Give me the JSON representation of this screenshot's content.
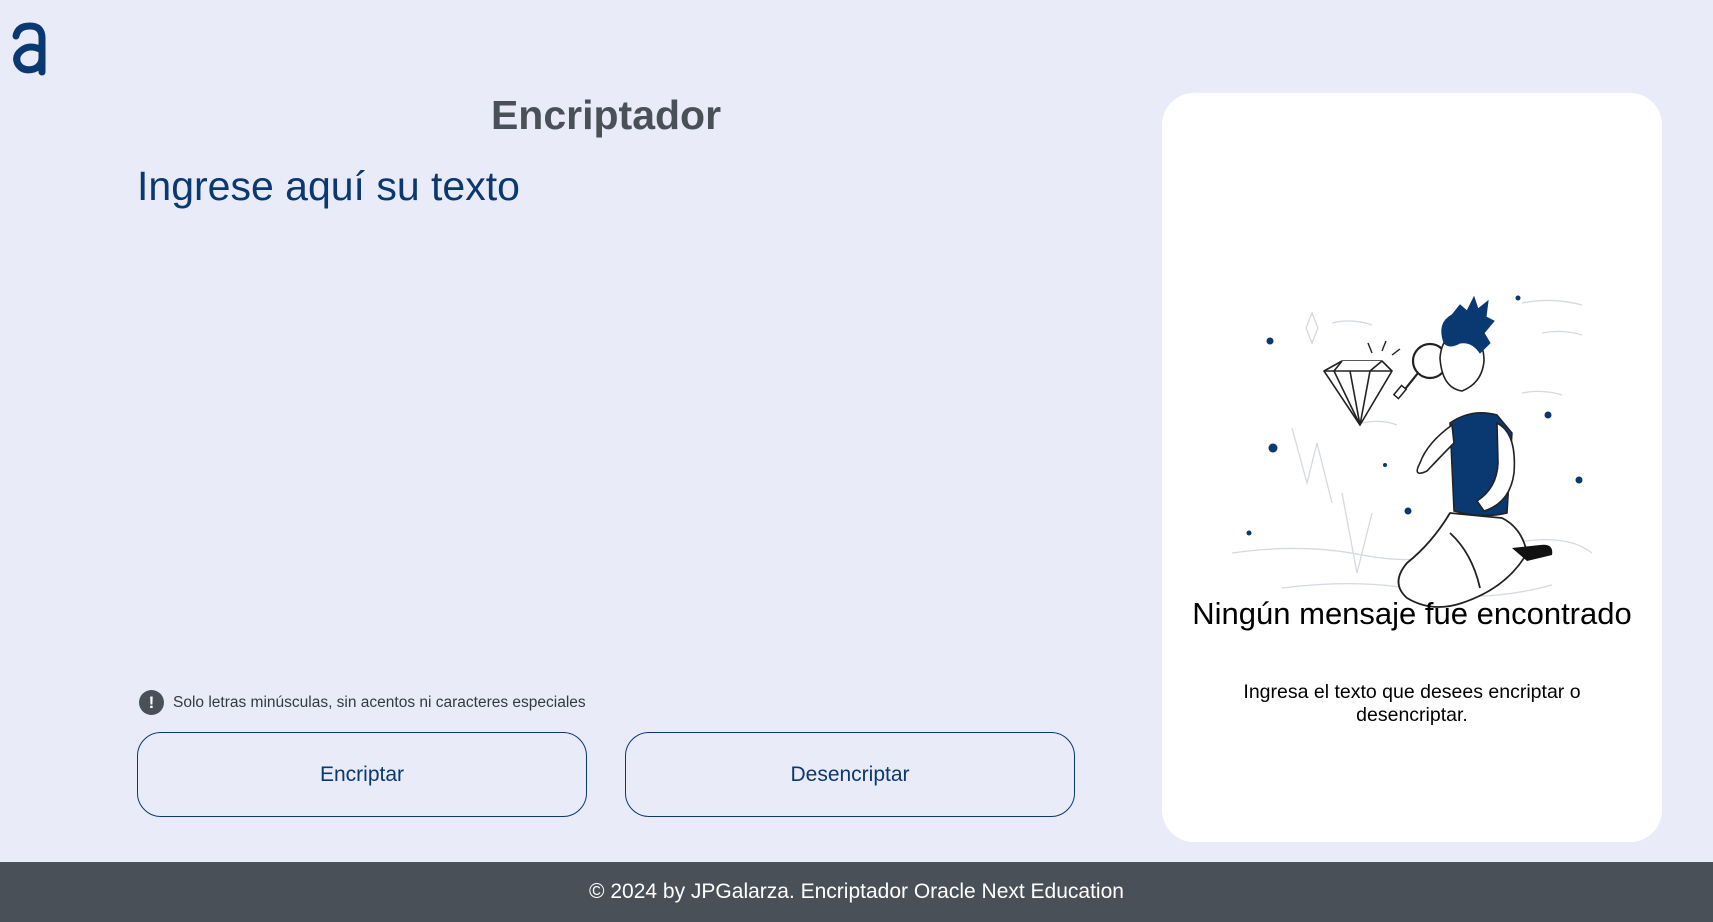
{
  "header": {
    "logo_letter": "a",
    "title": "Encriptador"
  },
  "input": {
    "placeholder": "Ingrese aquí su texto",
    "value": ""
  },
  "hint": {
    "icon": "exclamation-icon",
    "glyph": "!",
    "text": "Solo letras minúsculas, sin acentos ni caracteres especiales"
  },
  "buttons": {
    "encrypt_label": "Encriptar",
    "decrypt_label": "Desencriptar"
  },
  "result_panel": {
    "illustration": "person-inspecting-diamond-illustration",
    "title": "Ningún mensaje fue encontrado",
    "subtitle": "Ingresa el texto que desees encriptar o desencriptar."
  },
  "footer": {
    "text": "© 2024 by JPGalarza. Encriptador Oracle Next Education"
  },
  "colors": {
    "background": "#e9ecf8",
    "accent": "#0a3871",
    "footer": "#495057",
    "panel": "#ffffff"
  }
}
